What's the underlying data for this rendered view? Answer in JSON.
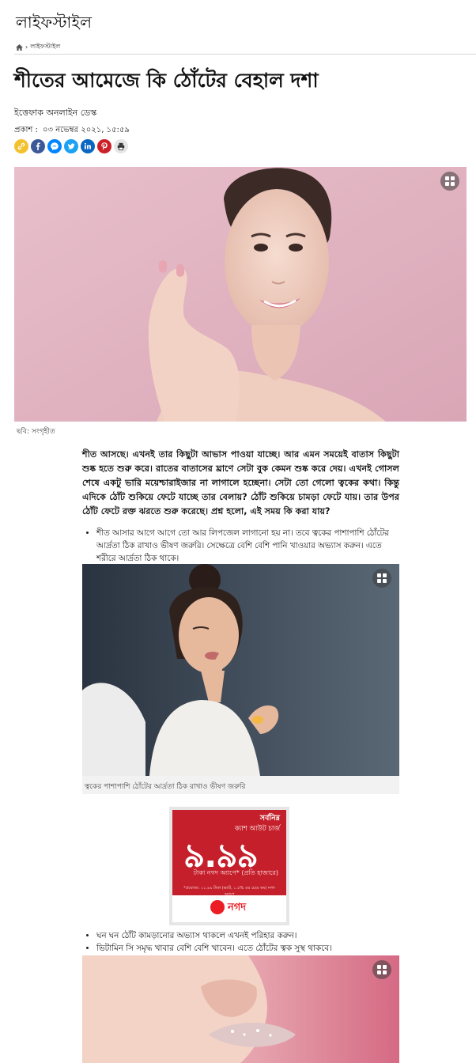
{
  "section": {
    "title": "লাইফস্টাইল"
  },
  "breadcrumb": {
    "home_icon": "home-icon",
    "separator": "›",
    "current": "লাইফস্টাইল"
  },
  "article": {
    "headline": "শীতের আমেজে কি ঠোঁটের বেহাল দশা",
    "author": "ইত্তেফাক অনলাইন ডেস্ক",
    "published_label": "প্রকাশ :",
    "published_date": "০৩ নভেম্বর ২০২১, ১৫:৫৯",
    "share_icons": [
      "link-icon",
      "facebook-icon",
      "messenger-icon",
      "twitter-icon",
      "linkedin-icon",
      "pinterest-icon",
      "print-icon"
    ],
    "hero_caption": "ছবি: সংগৃহীত",
    "lead": "শীত আসছে। এখনই তার কিছুটা আভাস পাওয়া যাচ্ছে। আর এমন সময়েই বাতাস কিছুটা শুষ্ক হতে শুরু করে। রাতের বাতাসের ঘ্রাণে সেটা বুক কেমন শুষ্ক করে দেয়। এখনই গোসল শেষে একটু ভারি ময়েশ্চারাইজার না লাগালে হচ্ছেনা। সেটা তো গেলো ত্বকের কথা। কিন্তু এদিকে ঠোঁট শুকিয়ে ফেটে যাচ্ছে তার বেলায়? ঠোঁট শুকিয়ে চামড়া ফেটে যায়। তার উপর ঠোঁট ফেটে রক্ত ঝরতে শুরু করেছে। প্রশ্ন হলো, এই সময় কি করা যায়?",
    "tips_1": [
      "শীত আসার আগে আগে তো আর লিপজেল লাগানো হয় না। তবে ত্বকের পাশাপাশি ঠোঁটের আর্দ্রতা ঠিক রাখাও ভীষণ জরুরি। সেক্ষেত্রে বেশি বেশি পানি খাওয়ার অভ্যাস করুন। এতে শরীরে আর্দ্রতা ঠিক থাকে।"
    ],
    "figure2_caption": "ত্বকের পাশাপাশি ঠোঁটের আর্দ্রতা ঠিক রাখাও ভীষণ জরুরি",
    "tips_2": [
      "ঘন ঘন ঠোঁট কামড়ানোর অভ্যাস থাকলে এখনই পরিহার করুন।",
      "ভিটামিন সি সমৃদ্ধ খাবার বেশি বেশি খাবেন। এতে ঠোঁটের ত্বক সুস্থ থাকবে।"
    ]
  },
  "ad": {
    "top": "সর্বনিম্ন",
    "sub": "ক্যাশ আউট চার্জ",
    "rate": "৯.৯৯",
    "unit": "টাকা নগদ অ্যাপে* (প্রতি হাজারে)",
    "note": "*প্রযোজ্য: ১১.৪৯ টাকা (ভ্যাট, ১.৫% এর চেয়ে কম) নগদ অ্যাপে",
    "brand": "নগদ",
    "brand_color": "#ec1c24",
    "bg_color": "#c41f2b"
  },
  "colors": {
    "facebook": "#3b5998",
    "messenger": "#0084ff",
    "twitter": "#1da1f2",
    "linkedin": "#0a66c2",
    "pinterest": "#cb2027",
    "link": "#f3c12e",
    "print": "#e6e6e6"
  }
}
